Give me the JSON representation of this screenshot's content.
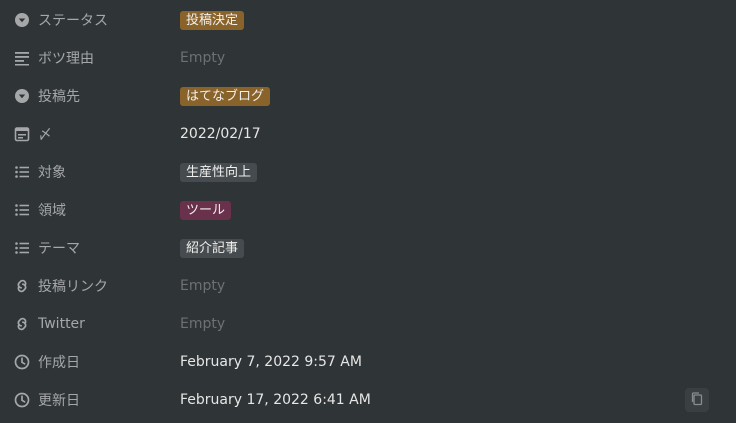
{
  "properties": [
    {
      "icon": "select-icon",
      "name": "ステータス",
      "type": "tag",
      "value": "投稿決定",
      "color": "#89632a"
    },
    {
      "icon": "text-icon",
      "name": "ボツ理由",
      "type": "empty",
      "value": "Empty"
    },
    {
      "icon": "select-icon",
      "name": "投稿先",
      "type": "tag",
      "value": "はてなブログ",
      "color": "#89632a"
    },
    {
      "icon": "calendar-icon",
      "name": "〆",
      "type": "text",
      "value": "2022/02/17"
    },
    {
      "icon": "multi-select-icon",
      "name": "対象",
      "type": "tag",
      "value": "生産性向上",
      "color": "#454b4e"
    },
    {
      "icon": "multi-select-icon",
      "name": "領域",
      "type": "tag",
      "value": "ツール",
      "color": "#69314c"
    },
    {
      "icon": "multi-select-icon",
      "name": "テーマ",
      "type": "tag",
      "value": "紹介記事",
      "color": "#454b4e"
    },
    {
      "icon": "link-icon",
      "name": "投稿リンク",
      "type": "empty",
      "value": "Empty"
    },
    {
      "icon": "link-icon",
      "name": "Twitter",
      "type": "empty",
      "value": "Empty"
    },
    {
      "icon": "clock-icon",
      "name": "作成日",
      "type": "text",
      "value": "February 7, 2022 9:57 AM"
    },
    {
      "icon": "clock-icon",
      "name": "更新日",
      "type": "text",
      "value": "February 17, 2022 6:41 AM"
    }
  ],
  "copy_button": {
    "icon": "copy-icon"
  }
}
